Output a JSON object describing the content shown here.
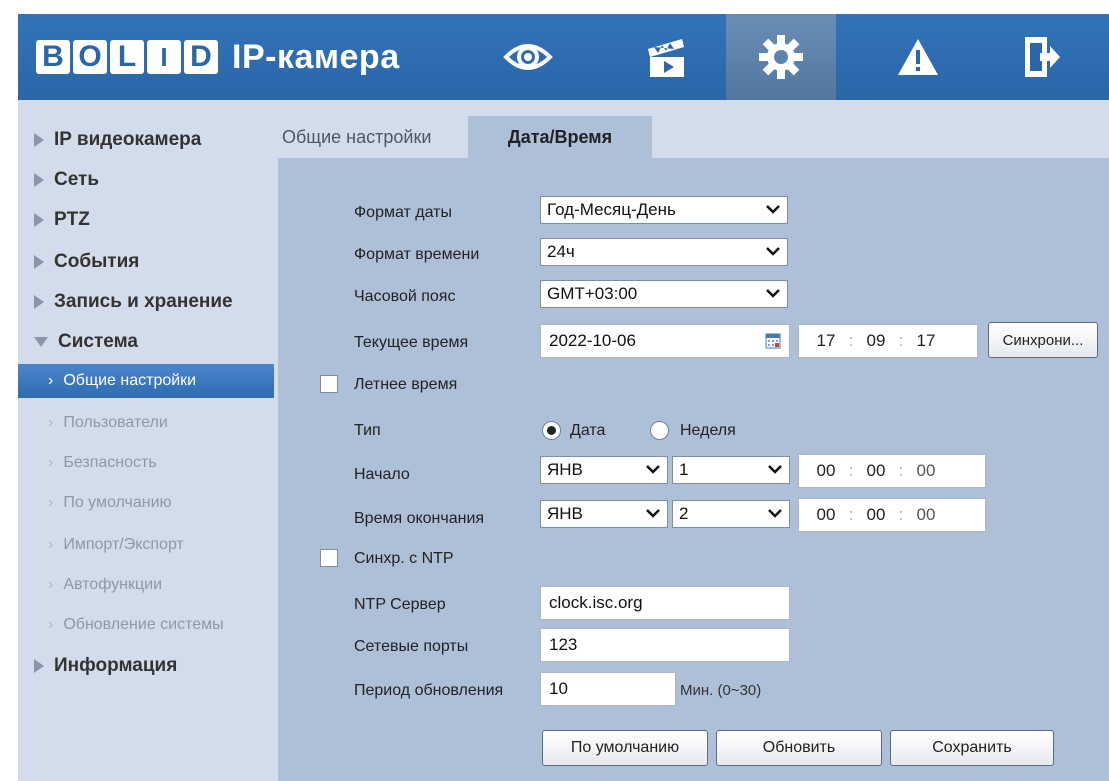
{
  "header": {
    "logo_text": "BOLID",
    "title": "IP-камера",
    "nav_icons": [
      "live-view-icon",
      "playback-icon",
      "settings-icon",
      "alarm-icon",
      "logout-icon"
    ],
    "colors": {
      "bar": "#2a66a8",
      "active": "#5e84ad"
    }
  },
  "sidebar": {
    "menu": [
      {
        "label": "IP видеокамера",
        "expanded": false
      },
      {
        "label": "Сеть",
        "expanded": false
      },
      {
        "label": "PTZ",
        "expanded": false
      },
      {
        "label": "События",
        "expanded": false
      },
      {
        "label": "Запись и хранение",
        "expanded": false
      },
      {
        "label": "Система",
        "expanded": true
      },
      {
        "label": "Информация",
        "expanded": false
      }
    ],
    "system_items": [
      {
        "label": "Общие настройки",
        "active": true
      },
      {
        "label": "Пользователи",
        "active": false
      },
      {
        "label": "Безпасность",
        "active": false
      },
      {
        "label": "По умолчанию",
        "active": false
      },
      {
        "label": "Импорт/Экспорт",
        "active": false
      },
      {
        "label": "Автофункции",
        "active": false
      },
      {
        "label": "Обновление системы",
        "active": false
      }
    ]
  },
  "tabs": [
    {
      "label": "Общие настройки",
      "active": false
    },
    {
      "label": "Дата/Время",
      "active": true
    }
  ],
  "form": {
    "date_format": {
      "label": "Формат даты",
      "value": "Год-Месяц-День"
    },
    "time_format": {
      "label": "Формат времени",
      "value": "24ч"
    },
    "timezone": {
      "label": "Часовой пояс",
      "value": "GMT+03:00"
    },
    "current_time": {
      "label": "Текущее время",
      "date": "2022-10-06",
      "hh": "17",
      "mm": "09",
      "ss": "17",
      "sync_button": "Синхрони..."
    },
    "dst": {
      "label": "Летнее время",
      "checked": false
    },
    "type": {
      "label": "Тип",
      "option_date": "Дата",
      "option_week": "Неделя",
      "selected": "Дата"
    },
    "start": {
      "label": "Начало",
      "month": "ЯНВ",
      "day": "1",
      "hh": "00",
      "mm": "00",
      "ss": "00"
    },
    "end": {
      "label": "Время окончания",
      "month": "ЯНВ",
      "day": "2",
      "hh": "00",
      "mm": "00",
      "ss": "00"
    },
    "ntp": {
      "label": "Синхр. с NTP",
      "checked": false
    },
    "ntp_server": {
      "label": "NTP Сервер",
      "value": "clock.isc.org"
    },
    "ports": {
      "label": "Сетевые порты",
      "value": "123"
    },
    "period": {
      "label": "Период обновления",
      "value": "10",
      "unit": "Мин. (0~30)"
    }
  },
  "buttons": {
    "default": "По умолчанию",
    "refresh": "Обновить",
    "save": "Сохранить"
  },
  "time_sep": ":"
}
